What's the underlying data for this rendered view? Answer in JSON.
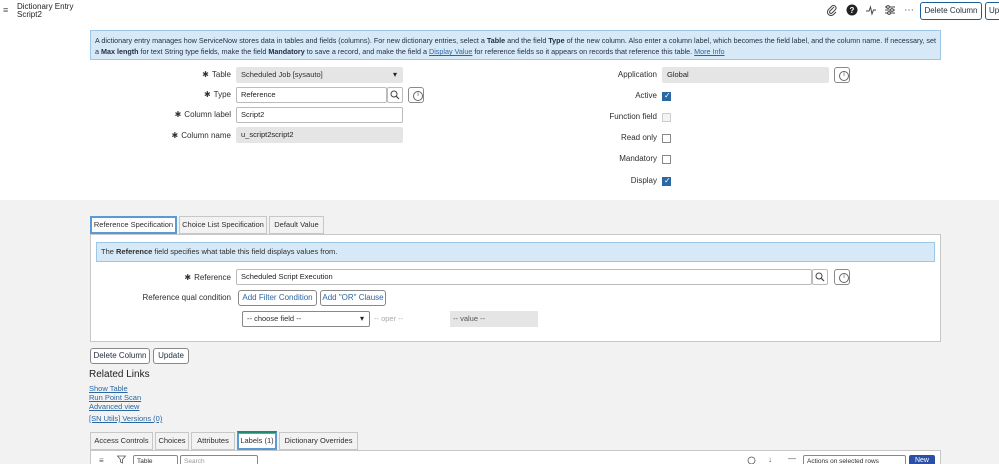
{
  "header": {
    "record_type": "Dictionary Entry",
    "record_name": "Script2",
    "delete_label": "Delete Column",
    "update_label": "Up",
    "icons": [
      "paperclip-icon",
      "help-icon",
      "activity-icon",
      "sliders-icon",
      "more-icon"
    ]
  },
  "info": {
    "t1": "A dictionary entry manages how ServiceNow stores data in tables and fields (columns). For new dictionary entries, select a ",
    "b1": "Table",
    "t2": " and the field ",
    "b2": "Type",
    "t3": " of the new column. Also enter a column label, which becomes the field label, and the column name. If necessary, set a ",
    "b3": "Max length",
    "t4": " for text String type fields, make the field ",
    "b4": "Mandatory",
    "t5": " to save a record, and make the field a ",
    "l1": "Display Value",
    "t6": " for reference fields so it appears on records that reference this table. ",
    "l2": "More Info"
  },
  "form": {
    "table_label": "Table",
    "table_value": "Scheduled Job [sysauto]",
    "type_label": "Type",
    "type_value": "Reference",
    "column_label_label": "Column label",
    "column_label_value": "Script2",
    "column_name_label": "Column name",
    "column_name_value": "u_script2script2",
    "application_label": "Application",
    "application_value": "Global",
    "active_label": "Active",
    "active": true,
    "function_field_label": "Function field",
    "function_field": false,
    "read_only_label": "Read only",
    "read_only": false,
    "mandatory_label": "Mandatory",
    "mandatory": false,
    "display_label": "Display",
    "display": true
  },
  "tabs": [
    {
      "label": "Reference Specification",
      "active": true
    },
    {
      "label": "Choice List Specification",
      "active": false
    },
    {
      "label": "Default Value",
      "active": false
    }
  ],
  "ref_spec": {
    "info_t1": "The ",
    "info_b": "Reference",
    "info_t2": " field specifies what table this field displays values from.",
    "reference_label": "Reference",
    "reference_value": "Scheduled Script Execution",
    "qual_label": "Reference qual condition",
    "add_filter": "Add Filter Condition",
    "add_or": "Add \"OR\" Clause",
    "choose_field": "-- choose field --",
    "oper": "-- oper --",
    "value": "-- value --"
  },
  "actions": {
    "delete": "Delete Column",
    "update": "Update"
  },
  "related": {
    "title": "Related Links",
    "links": [
      "Show Table",
      "Run Point Scan",
      "Advanced view",
      "[SN Utils] Versions (0)"
    ]
  },
  "related_tabs": [
    {
      "label": "Access Controls",
      "active": false
    },
    {
      "label": "Choices",
      "active": false
    },
    {
      "label": "Attributes",
      "active": false
    },
    {
      "label": "Labels (1)",
      "active": true
    },
    {
      "label": "Dictionary Overrides",
      "active": false
    }
  ],
  "list_toolbar": {
    "field_select": "Table",
    "search_placeholder": "Search",
    "actions_select": "Actions on selected rows",
    "new_label": "New"
  }
}
